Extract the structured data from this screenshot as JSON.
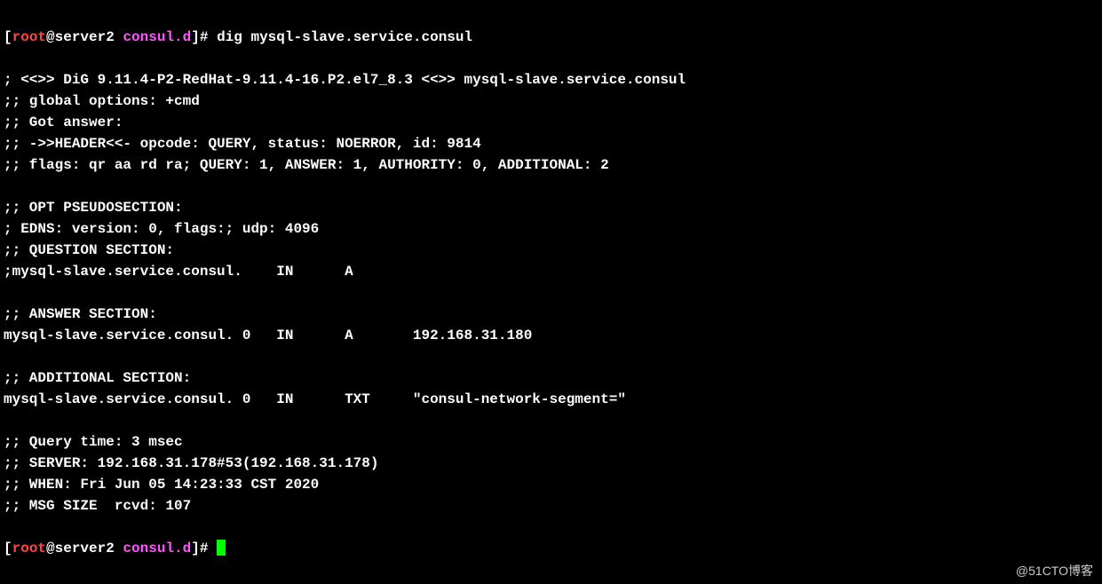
{
  "prompt1": {
    "open": "[",
    "user": "root",
    "at": "@server2 ",
    "dir": "consul.d",
    "close": "]# ",
    "cmd": "dig mysql-slave.service.consul"
  },
  "output": {
    "l1": "",
    "l2": "; <<>> DiG 9.11.4-P2-RedHat-9.11.4-16.P2.el7_8.3 <<>> mysql-slave.service.consul",
    "l3": ";; global options: +cmd",
    "l4": ";; Got answer:",
    "l5": ";; ->>HEADER<<- opcode: QUERY, status: NOERROR, id: 9814",
    "l6": ";; flags: qr aa rd ra; QUERY: 1, ANSWER: 1, AUTHORITY: 0, ADDITIONAL: 2",
    "l7": "",
    "l8": ";; OPT PSEUDOSECTION:",
    "l9": "; EDNS: version: 0, flags:; udp: 4096",
    "l10": ";; QUESTION SECTION:",
    "l11": ";mysql-slave.service.consul.    IN      A",
    "l12": "",
    "l13": ";; ANSWER SECTION:",
    "l14": "mysql-slave.service.consul. 0   IN      A       192.168.31.180",
    "l15": "",
    "l16": ";; ADDITIONAL SECTION:",
    "l17": "mysql-slave.service.consul. 0   IN      TXT     \"consul-network-segment=\"",
    "l18": "",
    "l19": ";; Query time: 3 msec",
    "l20": ";; SERVER: 192.168.31.178#53(192.168.31.178)",
    "l21": ";; WHEN: Fri Jun 05 14:23:33 CST 2020",
    "l22": ";; MSG SIZE  rcvd: 107",
    "l23": ""
  },
  "prompt2": {
    "open": "[",
    "user": "root",
    "at": "@server2 ",
    "dir": "consul.d",
    "close": "]# "
  },
  "watermark": "@51CTO博客"
}
